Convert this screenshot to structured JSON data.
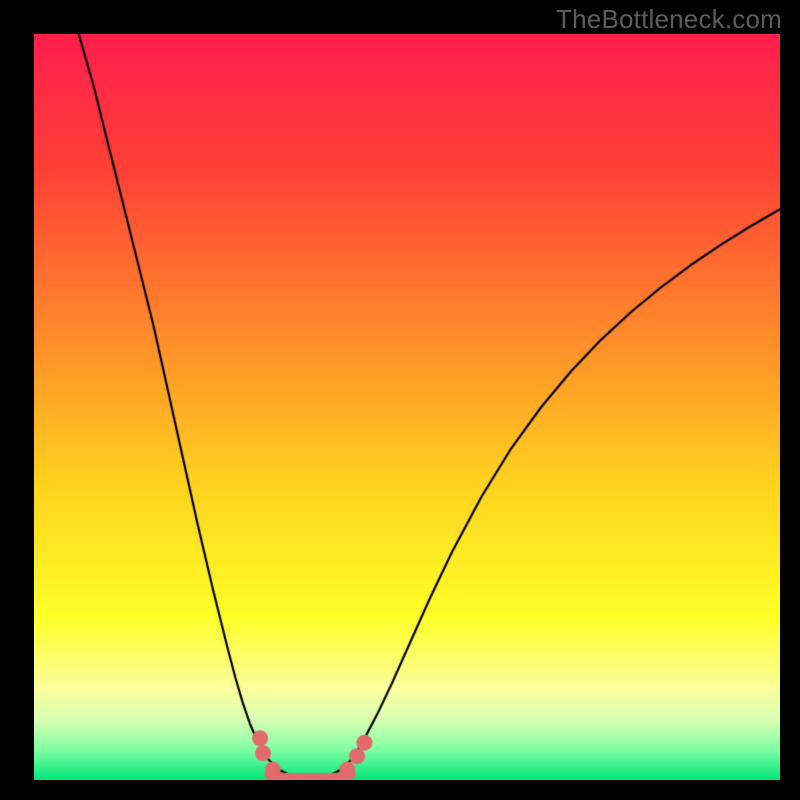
{
  "watermark": "TheBottleneck.com",
  "chart_data": {
    "type": "line",
    "title": "",
    "xlabel": "",
    "ylabel": "",
    "xlim": [
      0,
      100
    ],
    "ylim": [
      0,
      100
    ],
    "background_gradient": {
      "stops": [
        {
          "pos": 0.0,
          "color": "#ff1f4d"
        },
        {
          "pos": 0.18,
          "color": "#ff4037"
        },
        {
          "pos": 0.4,
          "color": "#ff8a2a"
        },
        {
          "pos": 0.6,
          "color": "#ffd21f"
        },
        {
          "pos": 0.78,
          "color": "#ffff27"
        },
        {
          "pos": 0.88,
          "color": "#fbffa0"
        },
        {
          "pos": 0.92,
          "color": "#d7ffb3"
        },
        {
          "pos": 0.96,
          "color": "#7effa3"
        },
        {
          "pos": 1.0,
          "color": "#00e77a"
        }
      ]
    },
    "series": [
      {
        "name": "left-branch",
        "color": "#000000",
        "width": 2.2,
        "x": [
          6.0,
          8.0,
          10.0,
          12.0,
          14.0,
          16.0,
          18.0,
          20.0,
          22.0,
          24.0,
          26.0,
          27.0,
          28.0,
          29.0,
          30.0,
          31.0,
          32.0,
          33.0,
          34.0
        ],
        "values": [
          100.0,
          93.0,
          85.0,
          77.0,
          69.0,
          61.0,
          52.0,
          43.0,
          34.0,
          25.5,
          17.5,
          13.7,
          10.3,
          7.4,
          5.1,
          3.3,
          2.1,
          1.3,
          0.8
        ]
      },
      {
        "name": "right-branch",
        "color": "#000000",
        "width": 2.2,
        "x": [
          40.0,
          41.0,
          42.0,
          43.0,
          44.0,
          46.0,
          48.0,
          50.0,
          53.0,
          56.0,
          60.0,
          64.0,
          68.0,
          72.0,
          76.0,
          80.0,
          84.0,
          88.0,
          92.0,
          96.0,
          100.0
        ],
        "values": [
          0.8,
          1.3,
          2.1,
          3.4,
          5.0,
          8.8,
          13.0,
          17.5,
          24.2,
          30.5,
          38.0,
          44.5,
          50.0,
          54.8,
          59.0,
          62.7,
          66.0,
          69.0,
          71.7,
          74.2,
          76.5
        ]
      },
      {
        "name": "valley-floor",
        "color": "#e26a6a",
        "width": 9,
        "x": [
          31.5,
          33.0,
          35.0,
          37.0,
          39.0,
          41.0,
          42.5
        ],
        "values": [
          0.7,
          0.4,
          0.3,
          0.3,
          0.3,
          0.4,
          0.7
        ]
      }
    ],
    "markers": [
      {
        "name": "dot-left-upper",
        "x": 30.3,
        "y": 5.6,
        "r": 8,
        "color": "#e26a6a"
      },
      {
        "name": "dot-left-lower",
        "x": 30.7,
        "y": 3.6,
        "r": 8,
        "color": "#e26a6a"
      },
      {
        "name": "dot-left-base",
        "x": 32.0,
        "y": 1.4,
        "r": 8,
        "color": "#e26a6a"
      },
      {
        "name": "dot-right-base",
        "x": 42.0,
        "y": 1.4,
        "r": 8,
        "color": "#e26a6a"
      },
      {
        "name": "dot-right-mid",
        "x": 43.3,
        "y": 3.2,
        "r": 8,
        "color": "#e26a6a"
      },
      {
        "name": "dot-right-upper",
        "x": 44.3,
        "y": 5.0,
        "r": 8,
        "color": "#e26a6a"
      }
    ]
  }
}
